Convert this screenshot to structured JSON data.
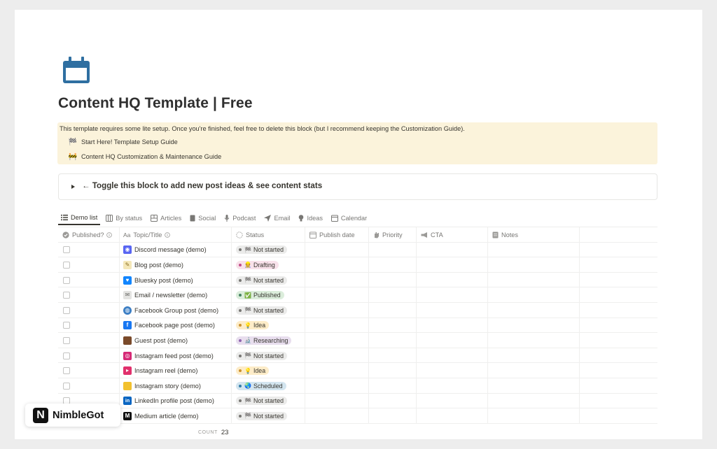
{
  "page": {
    "title": "Content HQ Template | Free",
    "icon": "calendar-icon"
  },
  "callout": {
    "text": "This template requires some lite setup. Once you're finished, feel free to delete this block (but I recommend keeping the Customization Guide).",
    "links": [
      {
        "emoji": "🏁",
        "label": "Start Here! Template Setup Guide"
      },
      {
        "emoji": "🚧",
        "label": "Content HQ Customization & Maintenance Guide"
      }
    ]
  },
  "toggle": {
    "text": "← Toggle this block to add new post ideas & see content stats"
  },
  "tabs": [
    {
      "label": "Demo list",
      "icon": "list-icon",
      "active": true
    },
    {
      "label": "By status",
      "icon": "board-icon",
      "active": false
    },
    {
      "label": "Articles",
      "icon": "gallery-icon",
      "active": false
    },
    {
      "label": "Social",
      "icon": "phone-icon",
      "active": false
    },
    {
      "label": "Podcast",
      "icon": "microphone-icon",
      "active": false
    },
    {
      "label": "Email",
      "icon": "send-icon",
      "active": false
    },
    {
      "label": "Ideas",
      "icon": "lightbulb-icon",
      "active": false
    },
    {
      "label": "Calendar",
      "icon": "calendar-icon",
      "active": false
    }
  ],
  "table": {
    "columns": [
      {
        "label": "Published?",
        "icon": "check-circle-icon",
        "info": true
      },
      {
        "label": "Topic/Title",
        "icon": "text-icon",
        "prefix": "Aa",
        "info": true
      },
      {
        "label": "Status",
        "icon": "status-icon"
      },
      {
        "label": "Publish date",
        "icon": "date-icon"
      },
      {
        "label": "Priority",
        "icon": "hand-icon"
      },
      {
        "label": "CTA",
        "icon": "megaphone-icon"
      },
      {
        "label": "Notes",
        "icon": "notes-icon"
      }
    ],
    "rows": [
      {
        "title": "Discord message (demo)",
        "icon": "discord-icon",
        "status": "Not started",
        "status_emoji": "🏁",
        "status_type": "gray"
      },
      {
        "title": "Blog post (demo)",
        "icon": "memo-icon",
        "status": "Drafting",
        "status_emoji": "👷",
        "status_type": "pink"
      },
      {
        "title": "Bluesky post (demo)",
        "icon": "bluesky-icon",
        "status": "Not started",
        "status_emoji": "🏁",
        "status_type": "gray"
      },
      {
        "title": "Email / newsletter (demo)",
        "icon": "envelope-icon",
        "status": "Published",
        "status_emoji": "✅",
        "status_type": "green"
      },
      {
        "title": "Facebook Group post (demo)",
        "icon": "globe-icon",
        "status": "Not started",
        "status_emoji": "🏁",
        "status_type": "gray"
      },
      {
        "title": "Facebook page post (demo)",
        "icon": "facebook-icon",
        "status": "Idea",
        "status_emoji": "💡",
        "status_type": "yellow"
      },
      {
        "title": "Guest post (demo)",
        "icon": "door-icon",
        "status": "Researching",
        "status_emoji": "🔬",
        "status_type": "purple"
      },
      {
        "title": "Instagram feed post (demo)",
        "icon": "instagram-icon",
        "status": "Not started",
        "status_emoji": "🏁",
        "status_type": "gray"
      },
      {
        "title": "Instagram reel (demo)",
        "icon": "instagram-reel-icon",
        "status": "Idea",
        "status_emoji": "💡",
        "status_type": "yellow"
      },
      {
        "title": "Instagram story (demo)",
        "icon": "story-icon",
        "status": "Scheduled",
        "status_emoji": "🌏",
        "status_type": "blue"
      },
      {
        "title": "LinkedIn profile post (demo)",
        "icon": "linkedin-icon",
        "status": "Not started",
        "status_emoji": "🏁",
        "status_type": "gray"
      },
      {
        "title": "Medium article (demo)",
        "icon": "medium-icon",
        "status": "Not started",
        "status_emoji": "🏁",
        "status_type": "gray"
      }
    ],
    "count_label": "COUNT",
    "count_value": "23"
  },
  "status_colors": {
    "gray": {
      "bg": "#ebebea",
      "dot": "#787774"
    },
    "pink": {
      "bg": "#f8e1ea",
      "dot": "#c14c8a"
    },
    "green": {
      "bg": "#dbeddb",
      "dot": "#448361"
    },
    "yellow": {
      "bg": "#fdecc8",
      "dot": "#cb912f"
    },
    "purple": {
      "bg": "#e8deee",
      "dot": "#9065b0"
    },
    "blue": {
      "bg": "#d3e5ef",
      "dot": "#337ea9"
    }
  },
  "colors": {
    "calendar_icon": "#2f6fa1",
    "callout_bg": "#fbf3db",
    "discord": "#5865f2",
    "bluesky": "#1185fe",
    "facebook": "#1877f2",
    "linkedin": "#0a66c2",
    "instagram": "#d62976",
    "medium": "#111111"
  },
  "brand": {
    "logo_letter": "N",
    "name": "NimbleGot"
  }
}
